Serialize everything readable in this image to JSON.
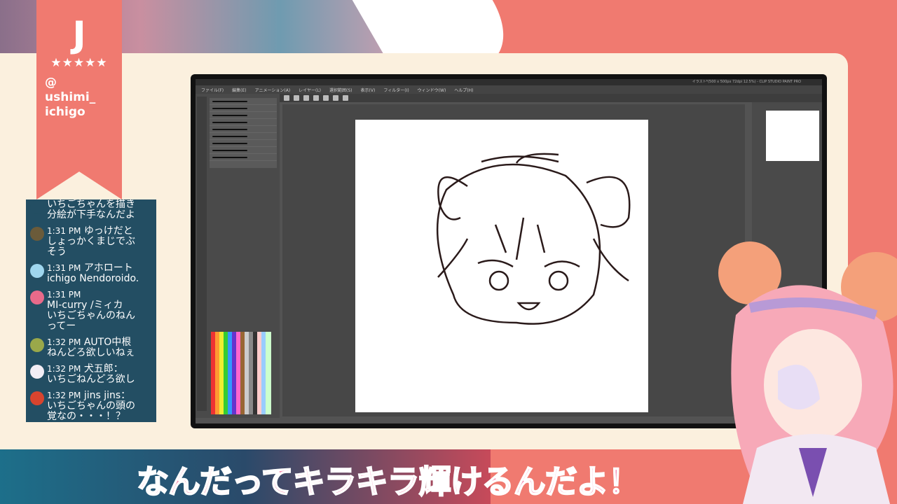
{
  "streamer": {
    "logo": "J",
    "stars": "★★★★★",
    "handle_at": "@",
    "handle_line1": "ushimi_",
    "handle_line2": "ichigo"
  },
  "chat": [
    {
      "time": "",
      "author": "",
      "text": "いちごちゃんを描き",
      "text2": "分絵が下手なんだよ",
      "color": "#234e63"
    },
    {
      "time": "1:31 PM",
      "author": "ゆっけだと",
      "text": "しょっかくまじでぶ",
      "text2": "そう",
      "color": "#6b5b3a"
    },
    {
      "time": "1:31 PM",
      "author": "アホロート",
      "text": "ichigo Nendoroido.",
      "text2": "",
      "color": "#9fd6ee"
    },
    {
      "time": "1:31 PM",
      "author": "",
      "text": "MI-curry /ミィカ",
      "text2": "いちごちゃんのねん",
      "text3": "ってー",
      "color": "#e86a8a"
    },
    {
      "time": "1:32 PM",
      "author": "AUTO中根",
      "text": "ねんどろ欲しいねぇ",
      "text2": "",
      "color": "#9aa84a"
    },
    {
      "time": "1:32 PM",
      "author": "犬五郎：",
      "text": "いちごねんどろ欲し",
      "text2": "",
      "color": "#f2eef5"
    },
    {
      "time": "1:32 PM",
      "author": "jins jins：",
      "text": "いちごちゃんの頭の",
      "text2": "覚なの・・・！？",
      "color": "#d8442e"
    }
  ],
  "app": {
    "title": "イラスト*(500 x 500px 72dpi 12.5%) - CLIP STUDIO PAINT PRO",
    "menu": [
      "ファイル(F)",
      "編集(E)",
      "アニメーション(A)",
      "レイヤー(L)",
      "選択範囲(S)",
      "表示(V)",
      "フィルター(I)",
      "ウィンドウ(W)",
      "ヘルプ(H)"
    ]
  },
  "caption": "なんだってキラキラ輝けるんだよ！"
}
